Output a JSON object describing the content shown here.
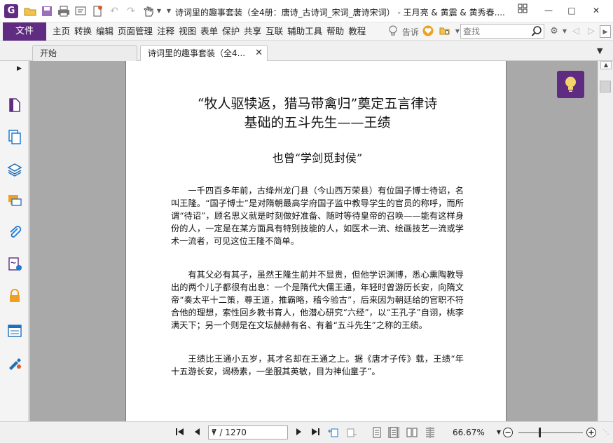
{
  "window": {
    "title": "诗词里的趣事套装（全4册：唐诗_古诗词_宋词_唐诗宋词） - 王月亮 & 黄震 & 黄秀春....",
    "app_icon_letter": "G",
    "controls": [
      "restore",
      "minimize",
      "maximize",
      "close"
    ]
  },
  "colors": {
    "brand": "#5f2c82",
    "background_area": "#a9a9a9"
  },
  "menu": {
    "file_label": "文件",
    "items": [
      "主页",
      "转换",
      "编辑",
      "页面管理",
      "注释",
      "视图",
      "表单",
      "保护",
      "共享",
      "互联",
      "辅助工具",
      "帮助",
      "教程"
    ],
    "tell_me_label": "告诉",
    "search_placeholder": "查找"
  },
  "tabs": [
    {
      "label": "开始",
      "active": false
    },
    {
      "label": "诗词里的趣事套装（全4...",
      "active": true
    }
  ],
  "left_panel": {
    "icons": [
      "page-thumbnail-icon",
      "pages-icon",
      "layers-icon",
      "comments-icon",
      "attachments-icon",
      "signature-icon",
      "security-icon",
      "form-fields-icon",
      "fill-sign-icon"
    ]
  },
  "document": {
    "title_line1": "“牧人驱犊返，猎马带禽归”奠定五言律诗",
    "title_line2": "基础的五斗先生——王绩",
    "subtitle": "也曾“学剑觅封侯”",
    "paragraphs": [
      "一千四百多年前，古绛州龙门县（今山西万荣县）有位国子博士待诏，名叫王隆。“国子博士”是对隋朝最高学府国子监中教导学生的官员的称呼，而所谓“待诏”，顾名思义就是时刻做好准备、随时等待皇帝的召唤——能有这样身份的人，一定是在某方面具有特别技能的人，如医术一流、绘画技艺一流或学术一流者，可见这位王隆不简单。",
      "有其父必有其子，虽然王隆生前并不显贵，但他学识渊博，悉心熏陶教导出的两个儿子都很有出息：一个是隋代大儒王通，年轻时曾游历长安，向隋文帝“奏太平十二策，尊王道，推霸略，稽今验古”，后来因为朝廷给的官职不符合他的理想，索性回乡教书育人，他潜心研究“六经”，以“王孔子”自诩，桃李满天下；另一个则是在文坛赫赫有名、有着“五斗先生”之称的王绩。",
      "王绩比王通小五岁，其才名却在王通之上。据《唐才子传》载，王绩“年十五游长安，谒杨素，一坐服其英敏，目为神仙童子”。"
    ]
  },
  "statusbar": {
    "page_display": "7 / 1270",
    "zoom_label": "66.67%",
    "zoom_level_percent": 66.67
  }
}
